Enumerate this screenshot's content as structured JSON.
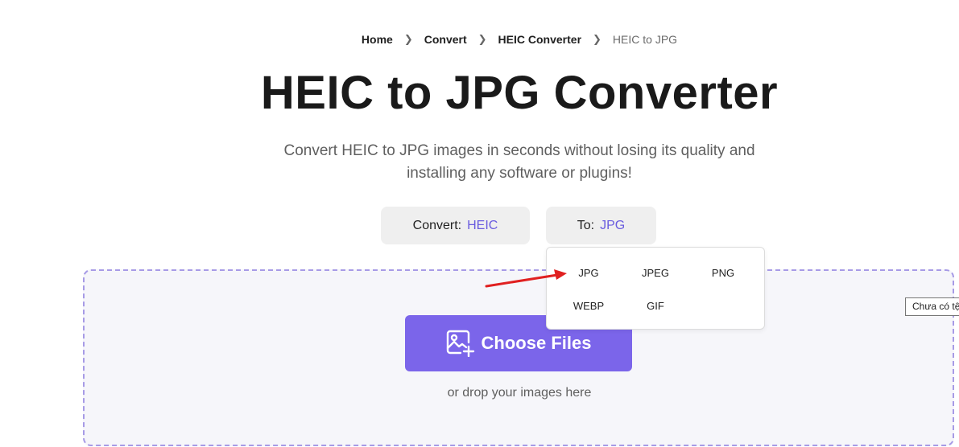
{
  "breadcrumb": {
    "items": [
      "Home",
      "Convert",
      "HEIC Converter"
    ],
    "current": "HEIC to JPG"
  },
  "title": "HEIC to JPG Converter",
  "subtitle": {
    "line1": "Convert HEIC to JPG images in seconds without losing its quality and",
    "line2": "installing any software or plugins!"
  },
  "convert_from": {
    "label": "Convert:",
    "value": "HEIC"
  },
  "convert_to": {
    "label": "To:",
    "value": "JPG"
  },
  "dropdown": {
    "options": [
      "JPG",
      "JPEG",
      "PNG",
      "WEBP",
      "GIF"
    ]
  },
  "upload": {
    "button_label": "Choose Files",
    "hint": "or drop your images here",
    "tooltip": "Chưa có tệp"
  },
  "colors": {
    "accent": "#7b65ea",
    "accent_text": "#6a5cdf",
    "annotation_arrow": "#e02020"
  }
}
